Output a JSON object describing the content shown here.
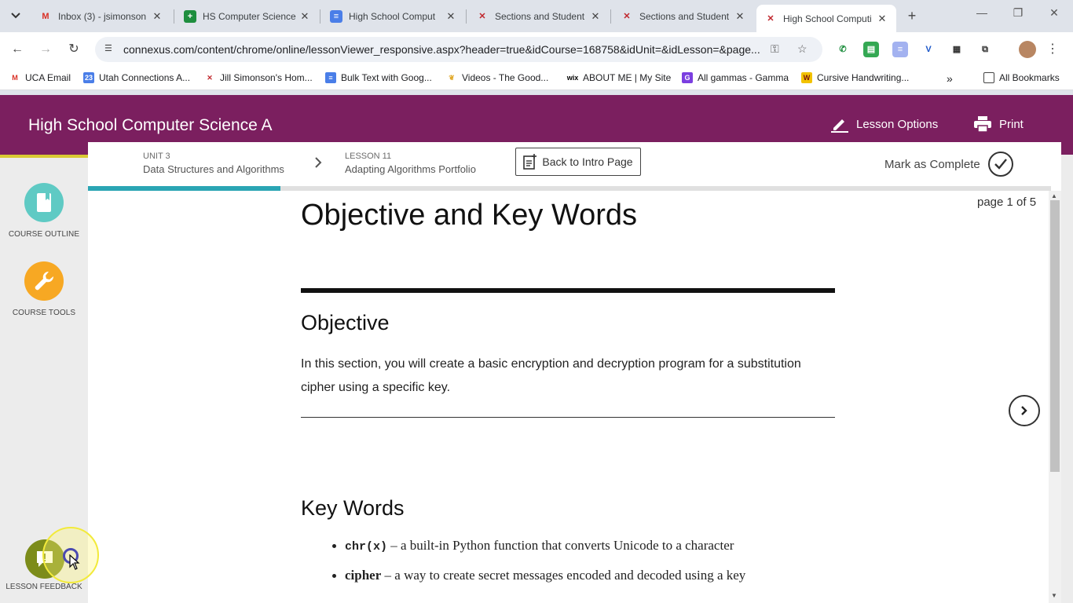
{
  "browser": {
    "tabs": [
      {
        "title": "Inbox (3) - jsimonson",
        "icon": "gmail-icon"
      },
      {
        "title": "HS Computer Science",
        "icon": "sheets-icon"
      },
      {
        "title": "High School Comput",
        "icon": "docs-icon"
      },
      {
        "title": "Sections and Student",
        "icon": "connexus-icon"
      },
      {
        "title": "Sections and Student",
        "icon": "connexus-icon"
      },
      {
        "title": "High School Computi",
        "icon": "connexus-icon",
        "active": true
      }
    ],
    "url": "connexus.com/content/chrome/online/lessonViewer_responsive.aspx?header=true&idCourse=168758&idUnit=&idLesson=&page...",
    "bookmarks": [
      {
        "label": "UCA Email",
        "icon": "gmail-icon"
      },
      {
        "label": "Utah Connections A...",
        "icon": "calendar-icon"
      },
      {
        "label": "Jill Simonson's Hom...",
        "icon": "connexus-icon"
      },
      {
        "label": "Bulk Text with Goog...",
        "icon": "docs-icon"
      },
      {
        "label": "Videos - The Good...",
        "icon": "leaf-icon"
      },
      {
        "label": "ABOUT ME | My Site",
        "icon": "wix-icon"
      },
      {
        "label": "All gammas - Gamma",
        "icon": "gamma-icon"
      },
      {
        "label": "Cursive Handwriting...",
        "icon": "w-icon"
      }
    ],
    "more_bookmarks": "»",
    "all_bookmarks": "All Bookmarks"
  },
  "header": {
    "course_title": "High School Computer Science A",
    "lesson_options": "Lesson Options",
    "print": "Print"
  },
  "sidebar": {
    "course_outline": "COURSE OUTLINE",
    "course_tools": "COURSE TOOLS",
    "lesson_feedback": "LESSON FEEDBACK"
  },
  "breadcrumb": {
    "unit_kicker": "UNIT 3",
    "unit_title": "Data Structures and Algorithms",
    "lesson_kicker": "LESSON 11",
    "lesson_title": "Adapting Algorithms Portfolio"
  },
  "actions": {
    "back_to_intro": "Back to Intro Page",
    "mark_complete": "Mark as Complete"
  },
  "progress": {
    "fraction": 0.2
  },
  "pager": {
    "page_text": "page 1 of 5"
  },
  "lesson": {
    "title": "Objective and Key Words",
    "objective_heading": "Objective",
    "objective_text": "In this section, you will create a basic encryption and decryption program for a substitution cipher using a specific key.",
    "keywords_heading": "Key Words",
    "keywords": [
      {
        "term": "chr(x)",
        "code": true,
        "definition": " – a built-in Python function that converts Unicode to a character"
      },
      {
        "term": "cipher",
        "code": false,
        "definition": " – a way to create secret messages encoded and decoded using a key"
      }
    ]
  },
  "colors": {
    "header_bg": "#7b1f5f",
    "progress": "#2aa5b4",
    "course_outline": "#5fcac4",
    "course_tools": "#f7a823",
    "feedback": "#7c8c1a"
  }
}
